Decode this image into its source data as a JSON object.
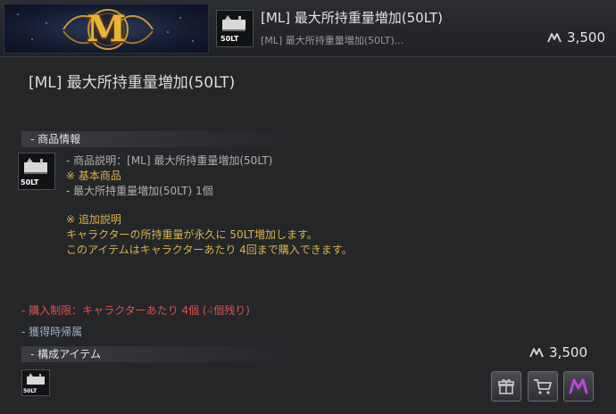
{
  "header": {
    "banner_letter": "M",
    "product_title": "[ML] 最大所持重量増加(50LT)",
    "product_subtitle": "[ML] 最大所持重量増加(50LT)...",
    "price": "3,500",
    "thumb_label": "50LT"
  },
  "detail": {
    "title": "[ML] 最大所持重量増加(50LT)",
    "product_info_section": "- 商品情報",
    "thumb_label": "50LT",
    "info_lines": [
      "- 商品説明：[ML] 最大所持重量増加(50LT)",
      "※ 基本商品",
      "- 最大所持重量増加(50LT) 1個"
    ],
    "additional_heading": "※ 追加説明",
    "additional_lines": [
      "キャラクターの所持重量が永久に 50LT増加します。",
      "このアイテムはキャラクターあたり 4回まで購入できます。"
    ],
    "purchase_limit_prefix": "- 購入制限：キャラクターあたり 4個 (",
    "purchase_limit_remain": "4",
    "purchase_limit_suffix": "個残り)",
    "bind_note": "- 獲得時帰属",
    "components_section": "- 構成アイテム",
    "components_thumb_label": "50LT",
    "total_price": "3,500"
  },
  "buttons": {
    "gift": "gift-icon",
    "cart": "cart-icon",
    "buy": "pearl-m-icon"
  },
  "colors": {
    "accent_gold": "#d8b34a",
    "limit_red": "#e05050",
    "pearl_purple": "#c045e0"
  }
}
